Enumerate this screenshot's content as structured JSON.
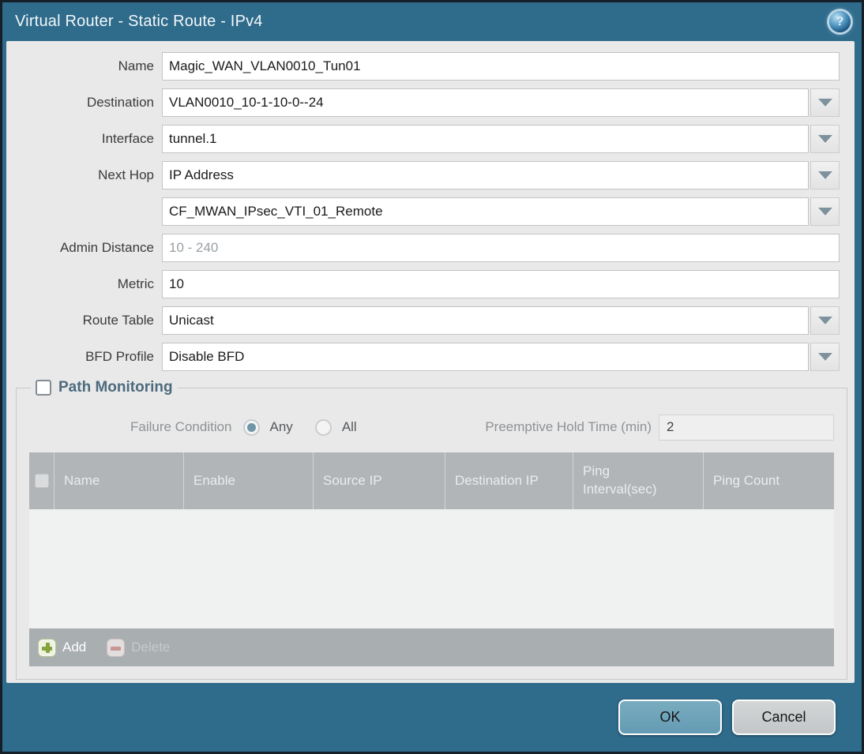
{
  "window": {
    "title": "Virtual Router - Static Route - IPv4"
  },
  "form": {
    "name": {
      "label": "Name",
      "value": "Magic_WAN_VLAN0010_Tun01"
    },
    "destination": {
      "label": "Destination",
      "value": "VLAN0010_10-1-10-0--24"
    },
    "interface": {
      "label": "Interface",
      "value": "tunnel.1"
    },
    "next_hop": {
      "label": "Next Hop",
      "value": "IP Address"
    },
    "next_hop_address": {
      "value": "CF_MWAN_IPsec_VTI_01_Remote"
    },
    "admin_distance": {
      "label": "Admin Distance",
      "placeholder": "10 - 240",
      "value": ""
    },
    "metric": {
      "label": "Metric",
      "value": "10"
    },
    "route_table": {
      "label": "Route Table",
      "value": "Unicast"
    },
    "bfd_profile": {
      "label": "BFD Profile",
      "value": "Disable BFD"
    }
  },
  "path_monitoring": {
    "legend": "Path Monitoring",
    "enabled": false,
    "failure_condition": {
      "label": "Failure Condition",
      "options": [
        "Any",
        "All"
      ],
      "selected": "Any"
    },
    "preemptive_hold_time": {
      "label": "Preemptive Hold Time (min)",
      "value": "2"
    },
    "table": {
      "columns": [
        "Name",
        "Enable",
        "Source IP",
        "Destination IP",
        "Ping Interval(sec)",
        "Ping Count"
      ],
      "rows": []
    },
    "toolbar": {
      "add_label": "Add",
      "delete_label": "Delete"
    }
  },
  "footer": {
    "ok_label": "OK",
    "cancel_label": "Cancel"
  },
  "icons": {
    "help": "help-icon",
    "dropdown": "chevron-down-icon",
    "add": "plus-icon",
    "delete": "minus-icon"
  },
  "colors": {
    "titlebar": "#2f6b8b",
    "content_bg": "#e9e9e9",
    "table_header": "#b1b5b7",
    "table_footer": "#a9aeb1",
    "radio_accent": "#6f96a6",
    "ok_button": "#6ba1b8",
    "cancel_button": "#c9cccd",
    "add_icon_green": "#86a23f",
    "delete_icon_red": "#d1908f"
  }
}
